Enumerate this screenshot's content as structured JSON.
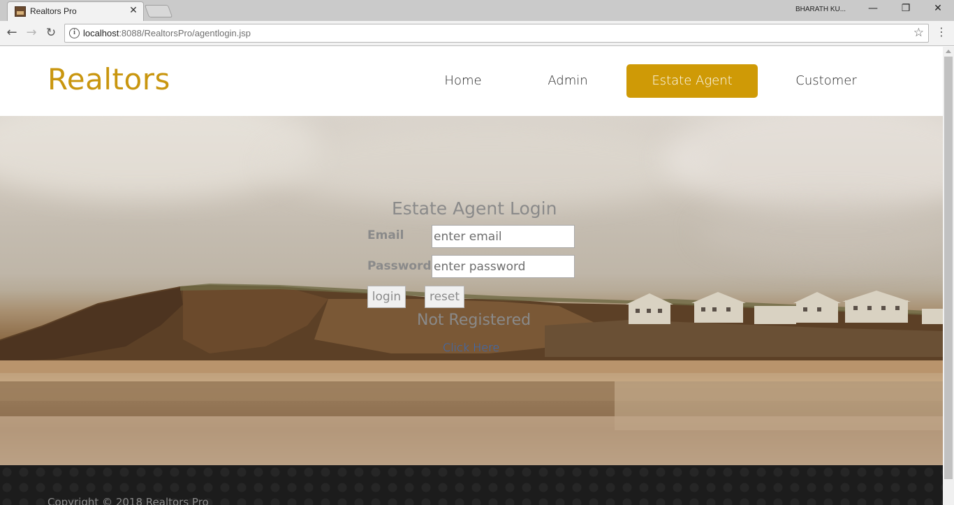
{
  "browser": {
    "tab_title": "Realtors Pro",
    "profile_name": "BHARATH KU...",
    "url_host": "localhost",
    "url_rest": ":8088/RealtorsPro/agentlogin.jsp"
  },
  "header": {
    "brand": "Realtors",
    "nav": [
      "Home",
      "Admin",
      "Estate Agent",
      "Customer"
    ],
    "active_nav": "Estate Agent",
    "accent_color": "#cf9a06"
  },
  "login": {
    "title": "Estate Agent Login",
    "email_label": "Email",
    "email_placeholder": "enter email",
    "password_label": "Password",
    "password_placeholder": "enter password",
    "login_button": "login",
    "reset_button": "reset",
    "not_registered": "Not Registered",
    "click_here": "Click Here"
  },
  "footer": {
    "copyright": "Copyright © 2018 Realtors Pro"
  }
}
